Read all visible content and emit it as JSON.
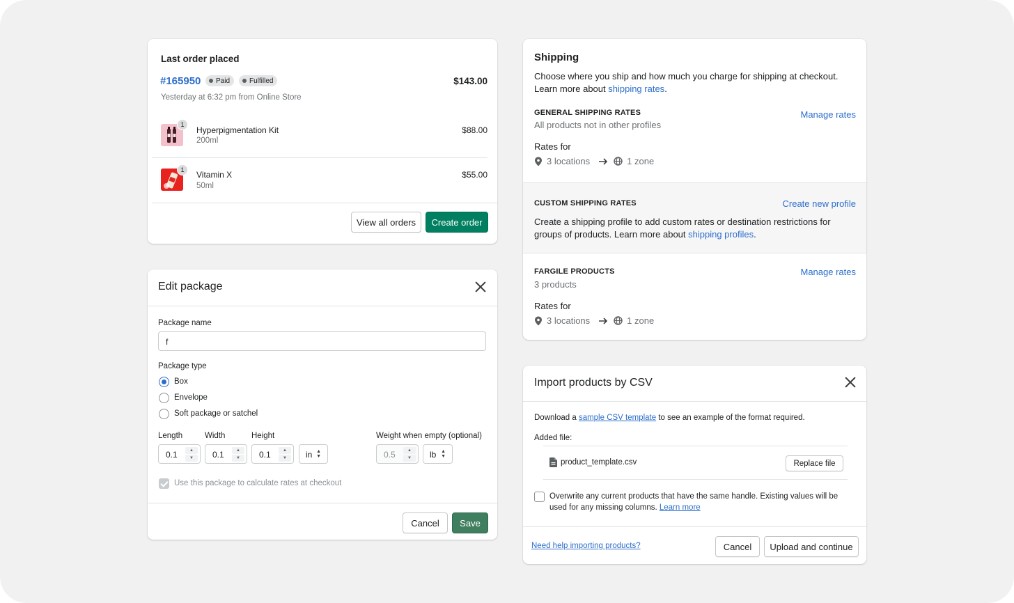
{
  "last_order": {
    "title": "Last order placed",
    "order_number": "#165950",
    "badges": [
      "Paid",
      "Fulfilled"
    ],
    "total": "$143.00",
    "meta": "Yesterday at 6:32 pm from Online Store",
    "items": [
      {
        "name": "Hyperpigmentation Kit",
        "variant": "200ml",
        "price": "$88.00",
        "qty": "1"
      },
      {
        "name": "Vitamin X",
        "variant": "50ml",
        "price": "$55.00",
        "qty": "1"
      }
    ],
    "view_all_label": "View all orders",
    "create_label": "Create order"
  },
  "edit_package": {
    "title": "Edit package",
    "name_label": "Package name",
    "name_value": "f",
    "type_label": "Package type",
    "types": [
      "Box",
      "Envelope",
      "Soft package or satchel"
    ],
    "selected_type": "Box",
    "length_label": "Length",
    "width_label": "Width",
    "height_label": "Height",
    "weight_label": "Weight when empty (optional)",
    "length_value": "0.1",
    "width_value": "0.1",
    "height_value": "0.1",
    "dim_unit": "in",
    "weight_value": "0.5",
    "weight_unit": "lb",
    "checkbox_label": "Use this package to calculate rates at checkout",
    "cancel_label": "Cancel",
    "save_label": "Save"
  },
  "shipping": {
    "title": "Shipping",
    "intro": "Choose where you ship and how much you charge for shipping at checkout.",
    "learn_prefix": "Learn more about ",
    "learn_link": "shipping rates",
    "learn_suffix": ".",
    "general": {
      "heading": "GENERAL SHIPPING RATES",
      "sub": "All products not in other profiles",
      "action": "Manage rates",
      "rates_for": "Rates for",
      "locations": "3 locations",
      "zone": "1 zone"
    },
    "custom": {
      "heading": "CUSTOM SHIPPING RATES",
      "action": "Create new profile",
      "text_line1": "Create a shipping profile to add custom rates or destination restrictions for",
      "text_line2_prefix": "groups of products. Learn more about ",
      "text_link": "shipping profiles",
      "text_suffix": "."
    },
    "fragile": {
      "heading": "FARGILE PRODUCTS",
      "sub": "3 products",
      "action": "Manage rates",
      "rates_for": "Rates for",
      "locations": "3 locations",
      "zone": "1 zone"
    }
  },
  "import_csv": {
    "title": "Import products by CSV",
    "download_prefix": "Download a ",
    "download_link": "sample CSV template",
    "download_suffix": " to see an example of the format required.",
    "added_file_label": "Added file:",
    "file_name": "product_template.csv",
    "replace_label": "Replace file",
    "overwrite_line1": "Overwrite any current products that have the same handle. Existing values will be",
    "overwrite_line2": "used for any missing columns. ",
    "overwrite_link": "Learn more",
    "help_link": "Need help importing products?",
    "cancel_label": "Cancel",
    "upload_label": "Upload and continue"
  },
  "colors": {
    "primary": "#008060",
    "link": "#2c6ecb",
    "background": "#f1f1f1"
  }
}
